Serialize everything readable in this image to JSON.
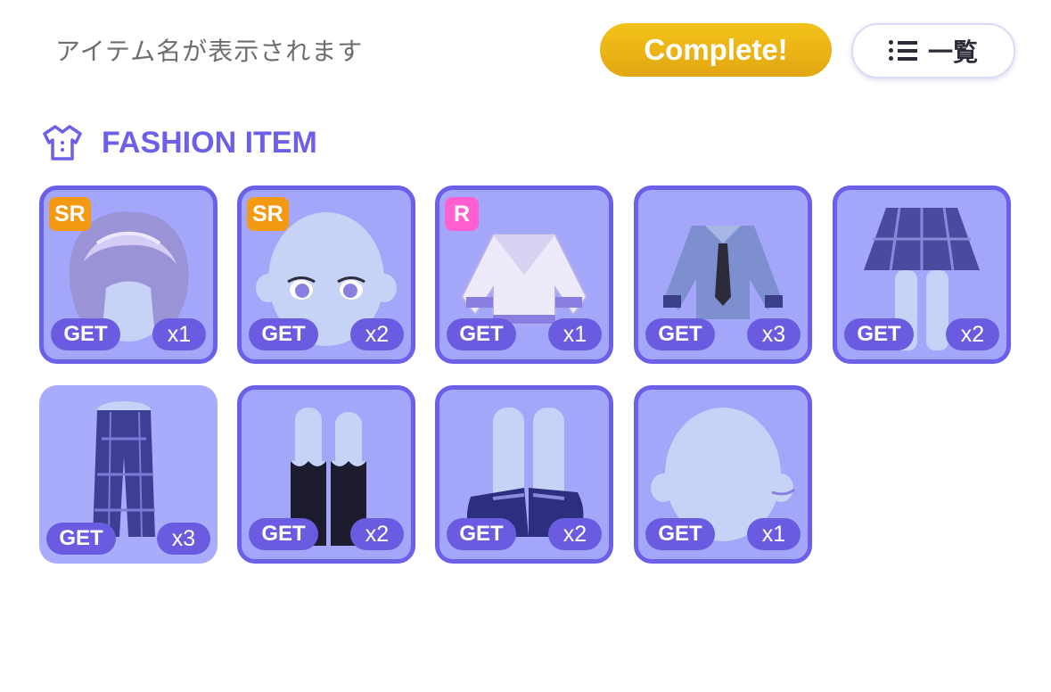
{
  "header": {
    "item_name_placeholder": "アイテム名が表示されます",
    "complete_label": "Complete!",
    "list_label": "一覧"
  },
  "section": {
    "title": "FASHION ITEM",
    "icon": "shirt-icon",
    "accent_color": "#6c5fe8"
  },
  "items": [
    {
      "name": "hair",
      "rarity": "SR",
      "get_label": "GET",
      "count": "x1"
    },
    {
      "name": "face",
      "rarity": "SR",
      "get_label": "GET",
      "count": "x2"
    },
    {
      "name": "jacket",
      "rarity": "R",
      "get_label": "GET",
      "count": "x1"
    },
    {
      "name": "shirt",
      "rarity": "",
      "get_label": "GET",
      "count": "x3"
    },
    {
      "name": "skirt",
      "rarity": "",
      "get_label": "GET",
      "count": "x2"
    },
    {
      "name": "pants",
      "rarity": "",
      "get_label": "GET",
      "count": "x3"
    },
    {
      "name": "socks",
      "rarity": "",
      "get_label": "GET",
      "count": "x2"
    },
    {
      "name": "shoes",
      "rarity": "",
      "get_label": "GET",
      "count": "x2"
    },
    {
      "name": "accessory",
      "rarity": "",
      "get_label": "GET",
      "count": "x1"
    }
  ]
}
